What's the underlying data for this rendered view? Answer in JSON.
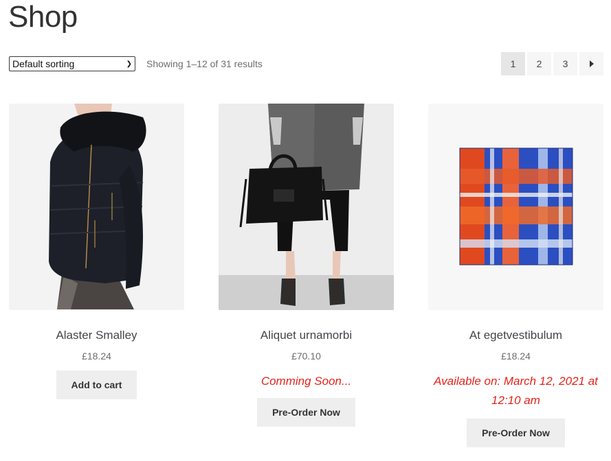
{
  "page": {
    "title": "Shop"
  },
  "toolbar": {
    "sort_selected": "Default sorting",
    "result_count": "Showing 1–12 of 31 results"
  },
  "pagination": {
    "pages": [
      "1",
      "2",
      "3"
    ],
    "current": "1",
    "next_icon": "arrow-right-icon"
  },
  "products": [
    {
      "name": "Alaster Smalley",
      "price": "£18.24",
      "button": "Add to cart"
    },
    {
      "name": "Aliquet urnamorbi",
      "price": "£70.10",
      "notice": "Comming Soon...",
      "button": "Pre-Order Now"
    },
    {
      "name": "At egetvestibulum",
      "price": "£18.24",
      "notice": "Available on: March 12, 2021 at 12:10 am",
      "button": "Pre-Order Now"
    }
  ],
  "colors": {
    "notice": "#e2231a",
    "button_bg": "#eeeeee",
    "pagination_bg": "#f6f6f6"
  }
}
